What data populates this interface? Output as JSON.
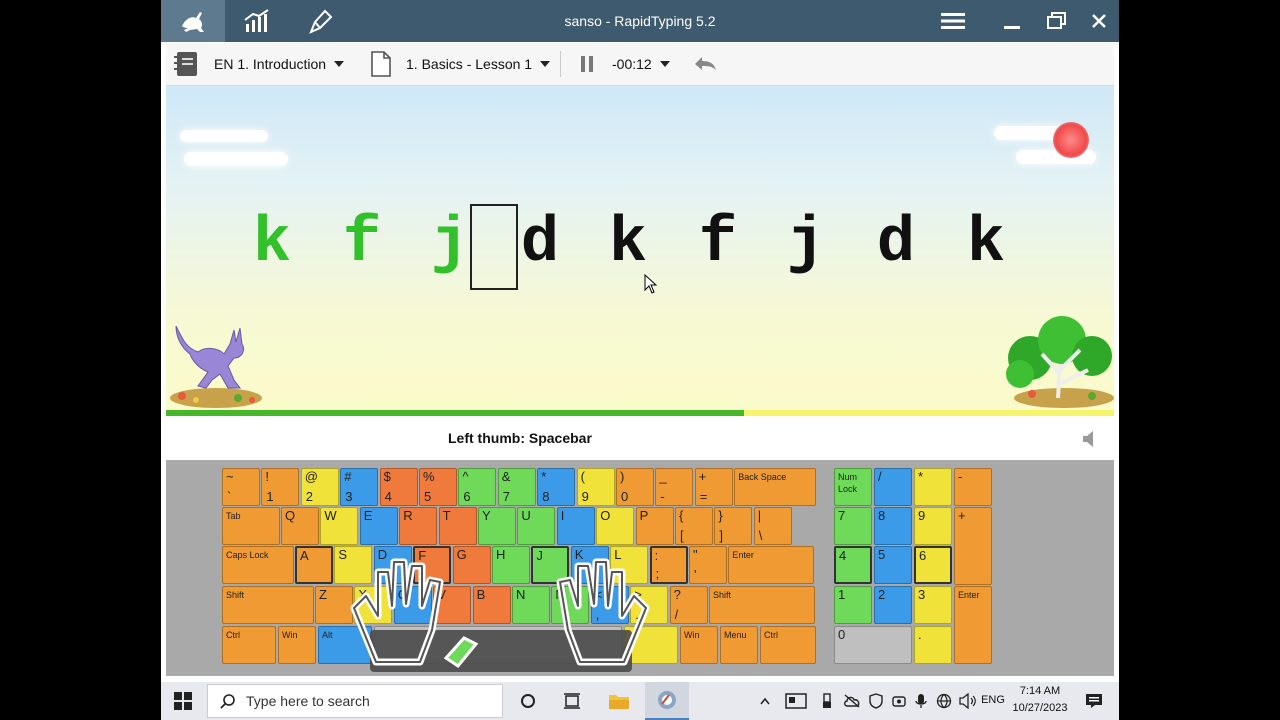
{
  "window": {
    "title": "sanso - RapidTyping 5.2",
    "tabs": [
      "typing-tutor-icon",
      "statistics-icon",
      "lesson-editor-icon"
    ]
  },
  "toolbar": {
    "course": "EN 1. Introduction",
    "lesson": "1. Basics - Lesson 1",
    "timer": "-00:12"
  },
  "exercise": {
    "letters": [
      "k",
      "f",
      "j",
      "d",
      "k",
      "f",
      "j",
      "d",
      "k"
    ],
    "typed_count": 3,
    "progress": 0.61
  },
  "hint": {
    "text": "Left thumb: Spacebar"
  },
  "keyboard": {
    "row0": [
      {
        "up": "~",
        "lo": "`",
        "c": "o"
      },
      {
        "up": "!",
        "lo": "1",
        "c": "o"
      },
      {
        "up": "@",
        "lo": "2",
        "c": "y"
      },
      {
        "up": "#",
        "lo": "3",
        "c": "b"
      },
      {
        "up": "$",
        "lo": "4",
        "c": "r"
      },
      {
        "up": "%",
        "lo": "5",
        "c": "r"
      },
      {
        "up": "^",
        "lo": "6",
        "c": "g"
      },
      {
        "up": "&",
        "lo": "7",
        "c": "g"
      },
      {
        "up": "*",
        "lo": "8",
        "c": "b"
      },
      {
        "up": "(",
        "lo": "9",
        "c": "y"
      },
      {
        "up": ")",
        "lo": "0",
        "c": "o"
      },
      {
        "up": "_",
        "lo": "-",
        "c": "o"
      },
      {
        "up": "+",
        "lo": "=",
        "c": "o"
      }
    ],
    "backspace": "Back Space",
    "tab": "Tab",
    "row1": [
      {
        "up": "Q",
        "c": "o"
      },
      {
        "up": "W",
        "c": "y"
      },
      {
        "up": "E",
        "c": "b"
      },
      {
        "up": "R",
        "c": "r"
      },
      {
        "up": "T",
        "c": "r"
      },
      {
        "up": "Y",
        "c": "g"
      },
      {
        "up": "U",
        "c": "g"
      },
      {
        "up": "I",
        "c": "b"
      },
      {
        "up": "O",
        "c": "y"
      },
      {
        "up": "P",
        "c": "o"
      },
      {
        "up": "{",
        "lo": "[",
        "c": "o"
      },
      {
        "up": "}",
        "lo": "]",
        "c": "o"
      },
      {
        "up": "|",
        "lo": "\\",
        "c": "o"
      }
    ],
    "caps": "Caps Lock",
    "row2": [
      {
        "up": "A",
        "c": "o"
      },
      {
        "up": "S",
        "c": "y"
      },
      {
        "up": "D",
        "c": "b"
      },
      {
        "up": "F",
        "c": "r"
      },
      {
        "up": "G",
        "c": "r"
      },
      {
        "up": "H",
        "c": "g"
      },
      {
        "up": "J",
        "c": "g"
      },
      {
        "up": "K",
        "c": "b"
      },
      {
        "up": "L",
        "c": "y"
      },
      {
        "up": ":",
        "lo": ";",
        "c": "o"
      },
      {
        "up": "\"",
        "lo": "'",
        "c": "o"
      }
    ],
    "enter": "Enter",
    "shift": "Shift",
    "row3": [
      {
        "up": "Z",
        "c": "o"
      },
      {
        "up": "X",
        "c": "y"
      },
      {
        "up": "C",
        "c": "b"
      },
      {
        "up": "V",
        "c": "r"
      },
      {
        "up": "B",
        "c": "r"
      },
      {
        "up": "N",
        "c": "g"
      },
      {
        "up": "M",
        "c": "g"
      },
      {
        "up": "<",
        "lo": ",",
        "c": "b"
      },
      {
        "up": ">",
        "lo": ".",
        "c": "y"
      },
      {
        "up": "?",
        "lo": "/",
        "c": "o"
      }
    ],
    "ctrl": "Ctrl",
    "win": "Win",
    "alt": "Alt",
    "menu": "Menu",
    "numpad": {
      "numlock": "Num Lock",
      "div": "/",
      "mul": "*",
      "minus": "-",
      "plus": "+",
      "n7": "7",
      "n8": "8",
      "n9": "9",
      "n4": "4",
      "n5": "5",
      "n6": "6",
      "n1": "1",
      "n2": "2",
      "n3": "3",
      "n0": "0",
      "dot": ".",
      "enter": "Enter"
    }
  },
  "taskbar": {
    "search_placeholder": "Type here to search",
    "lang": "ENG",
    "time": "7:14 AM",
    "date": "10/27/2023"
  },
  "colors": {
    "titlebar": "#3e5a6f",
    "typed": "#33c12b",
    "progress": "#46b62b"
  }
}
